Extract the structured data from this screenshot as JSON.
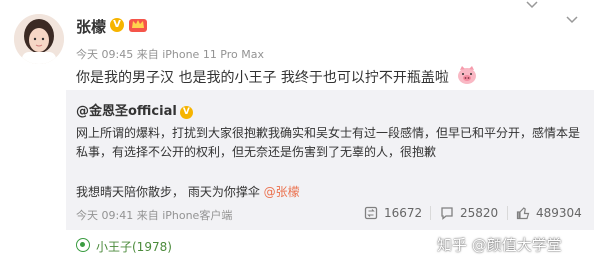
{
  "post": {
    "author": "张檬",
    "verified_badge": "V",
    "meta": "今天 09:45 来自 iPhone 11 Pro Max",
    "text": "你是我的男子汉  也是我的小王子  我终于也可以拧不开瓶盖啦"
  },
  "repost": {
    "author": "@金恩圣official",
    "verified_badge": "V",
    "line1": "网上所谓的爆料，打扰到大家很抱歉我确实和吴女士有过一段感情，但早已和平分开，感情本是",
    "line2": "私事，有选择不公开的权利，但无奈还是伤害到了无辜的人，很抱歉",
    "line3_prefix": "我想晴天陪你散步，  雨天为你撑伞 ",
    "line3_mention": "@张檬",
    "meta": "今天 09:41 来自 iPhone客户端",
    "stats": {
      "reposts": "16672",
      "comments": "25820",
      "likes": "489304"
    }
  },
  "footer": {
    "topic": "小王子(1978)",
    "watermark": "知乎 @颜值大学堂"
  },
  "colors": {
    "accent_orange": "#eb7350",
    "badge_gold": "#f6b400",
    "topic_green": "#4c8b3c",
    "repost_bg": "#f2f2f5"
  },
  "icons": [
    "chevron-down-icon",
    "crown-badge-icon",
    "pig-face-icon",
    "repost-icon",
    "comment-icon",
    "like-icon",
    "topic-icon"
  ]
}
